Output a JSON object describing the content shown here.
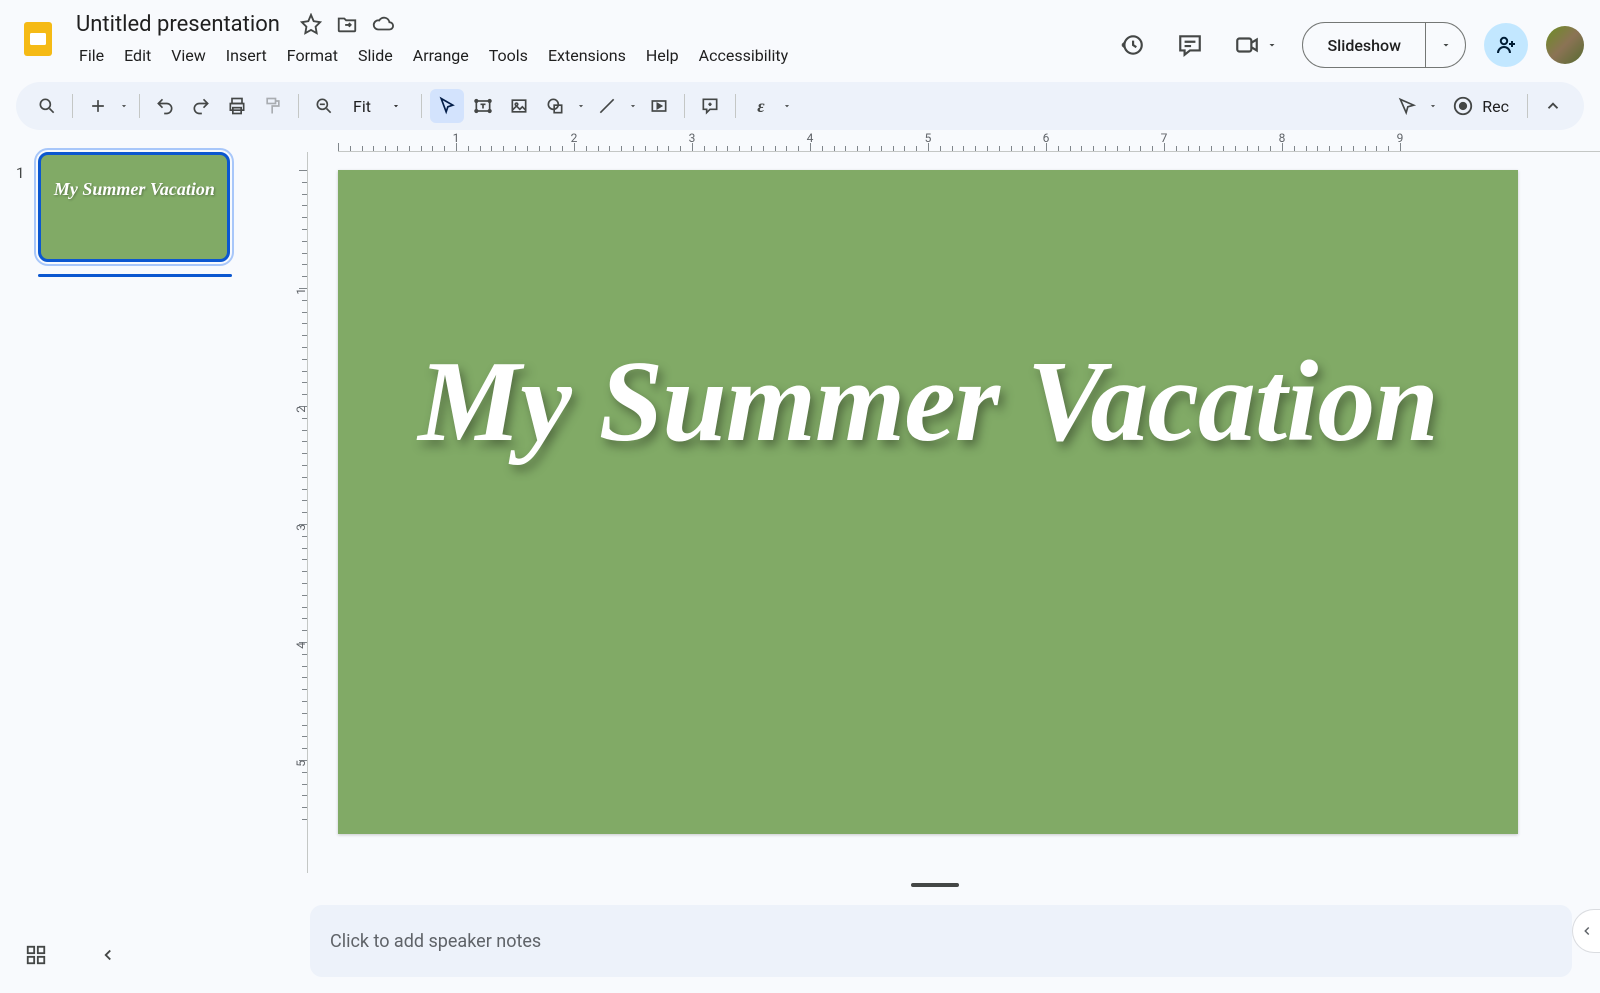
{
  "header": {
    "title": "Untitled presentation"
  },
  "menus": [
    "File",
    "Edit",
    "View",
    "Insert",
    "Format",
    "Slide",
    "Arrange",
    "Tools",
    "Extensions",
    "Help",
    "Accessibility"
  ],
  "toolbar": {
    "zoom": "Fit",
    "rec": "Rec"
  },
  "buttons": {
    "slideshow": "Slideshow"
  },
  "filmstrip": {
    "slideNumber": "1",
    "thumbTitle": "My Summer Vacation"
  },
  "slide": {
    "backgroundColor": "#81aa66",
    "title": "My Summer Vacation"
  },
  "notes": {
    "placeholder": "Click to add speaker notes"
  },
  "ruler": {
    "hLabels": [
      "1",
      "2",
      "3",
      "4",
      "5",
      "6",
      "7",
      "8",
      "9"
    ],
    "vLabels": [
      "1",
      "2",
      "3",
      "4",
      "5"
    ]
  }
}
